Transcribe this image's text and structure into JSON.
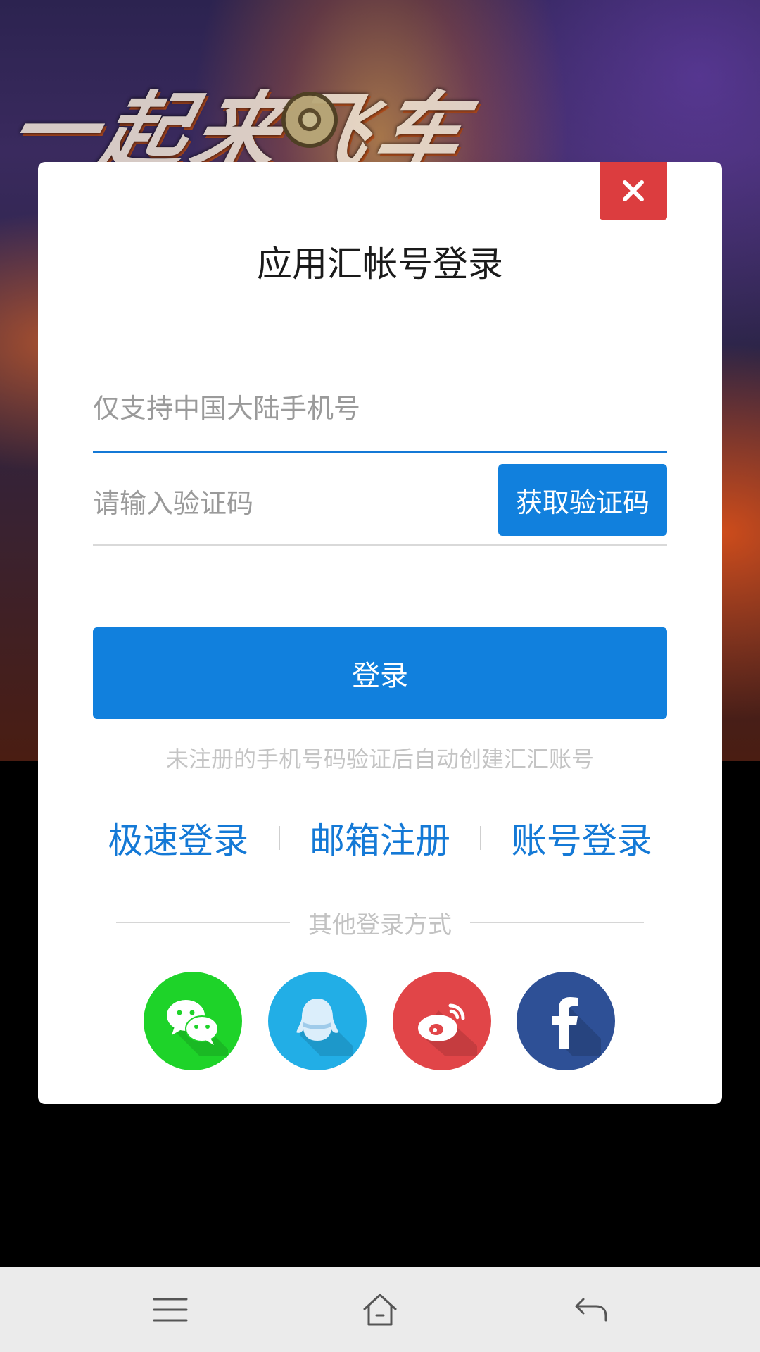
{
  "background": {
    "logo_text": "一起来飞车"
  },
  "dialog": {
    "title": "应用汇帐号登录",
    "close_icon": "close-icon",
    "phone_placeholder": "仅支持中国大陆手机号",
    "code_placeholder": "请输入验证码",
    "get_code_label": "获取验证码",
    "login_label": "登录",
    "hint": "未注册的手机号码验证后自动创建汇汇账号",
    "links": [
      "极速登录",
      "邮箱注册",
      "账号登录"
    ],
    "other_login_label": "其他登录方式",
    "social_icons": [
      "wechat-icon",
      "qq-icon",
      "weibo-icon",
      "facebook-icon"
    ]
  },
  "colors": {
    "accent_blue": "#1180dd",
    "close_red": "#dc3d3f",
    "wechat_green": "#1ed329",
    "qq_blue": "#22aee6",
    "weibo_red": "#e14548",
    "facebook_blue": "#2e5096"
  },
  "navbar": {
    "icons": [
      "menu-icon",
      "home-icon",
      "back-icon"
    ]
  }
}
